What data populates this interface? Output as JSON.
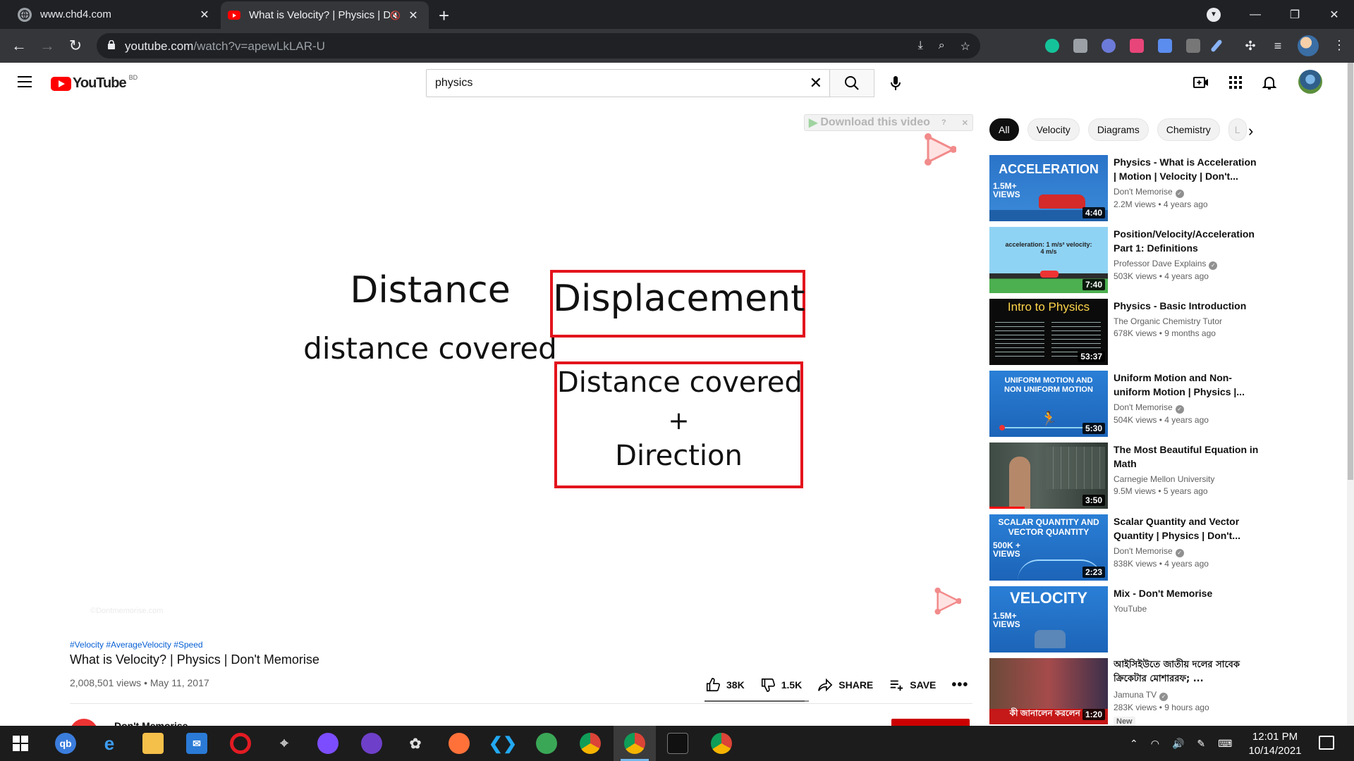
{
  "browser": {
    "tabs": [
      {
        "title": "www.chd4.com"
      },
      {
        "title": "What is Velocity? | Physics | D"
      }
    ],
    "url_host": "youtube.com",
    "url_path": "/watch?v=apewLkLAR-U"
  },
  "youtube": {
    "logo_text": "YouTube",
    "country_code": "BD",
    "search_value": "physics",
    "search_placeholder": "Search"
  },
  "video": {
    "download_banner": "Download this video",
    "board": {
      "left_heading": "Distance",
      "left_sub": "distance covered",
      "right_heading": "Displacement",
      "right_line1": "Distance covered",
      "right_plus": "+",
      "right_line2": "Direction"
    },
    "watermark": "©Dontmemorise.com",
    "hashtags": "#Velocity #AverageVelocity #Speed",
    "title": "What is Velocity? | Physics | Don't Memorise",
    "meta": "2,008,501 views • May 11, 2017",
    "likes": "38K",
    "dislikes": "1.5K",
    "share_label": "SHARE",
    "save_label": "SAVE",
    "like_ratio": 0.96,
    "channel_name": "Don't Memorise"
  },
  "chips": [
    "All",
    "Velocity",
    "Diagrams",
    "Chemistry",
    "L"
  ],
  "recommendations": [
    {
      "title": "Physics - What is Acceleration | Motion | Velocity | Don't...",
      "channel": "Don't Memorise",
      "verified": true,
      "stats": "2.2M views • 4 years ago",
      "duration": "4:40",
      "thumb_text": "ACCELERATION",
      "thumb_badge": "1.5M+ VIEWS",
      "new": ""
    },
    {
      "title": "Position/Velocity/Acceleration Part 1: Definitions",
      "channel": "Professor Dave Explains",
      "verified": true,
      "stats": "503K views • 4 years ago",
      "duration": "7:40",
      "thumb_text": "acceleration: 1 m/s²   velocity: 4 m/s",
      "thumb_badge": "",
      "new": ""
    },
    {
      "title": "Physics - Basic Introduction",
      "channel": "The Organic Chemistry Tutor",
      "verified": false,
      "stats": "678K views • 9 months ago",
      "duration": "53:37",
      "thumb_text": "Intro to Physics",
      "thumb_badge": "",
      "new": ""
    },
    {
      "title": "Uniform Motion and Non-uniform Motion | Physics |...",
      "channel": "Don't Memorise",
      "verified": true,
      "stats": "504K views • 4 years ago",
      "duration": "5:30",
      "thumb_text": "UNIFORM MOTION AND NON UNIFORM MOTION",
      "thumb_badge": "",
      "new": ""
    },
    {
      "title": "The Most Beautiful Equation in Math",
      "channel": "Carnegie Mellon University",
      "verified": false,
      "stats": "9.5M views • 5 years ago",
      "duration": "3:50",
      "thumb_text": "",
      "thumb_badge": "",
      "new": ""
    },
    {
      "title": "Scalar Quantity and Vector Quantity | Physics | Don't...",
      "channel": "Don't Memorise",
      "verified": true,
      "stats": "838K views • 4 years ago",
      "duration": "2:23",
      "thumb_text": "SCALAR QUANTITY AND VECTOR QUANTITY",
      "thumb_badge": "500K + VIEWS",
      "new": ""
    },
    {
      "title": "Mix - Don't Memorise",
      "channel": "YouTube",
      "verified": false,
      "stats": "",
      "duration": "",
      "thumb_text": "VELOCITY",
      "thumb_badge": "1.5M+ VIEWS",
      "new": ""
    },
    {
      "title": "আইসিইউতে জাতীয় দলের সাবেক ক্রিকেটার মোশাররফ; ...",
      "channel": "Jamuna TV",
      "verified": true,
      "stats": "283K views • 9 hours ago",
      "duration": "1:20",
      "thumb_text": "কী জানালেন করলেন ?",
      "thumb_badge": "",
      "new": "New"
    }
  ],
  "taskbar": {
    "time": "12:01 PM",
    "date": "10/14/2021"
  },
  "colors": {
    "yt_red": "#ff0000",
    "board_red": "#e3141c",
    "link_blue": "#065fd4"
  }
}
